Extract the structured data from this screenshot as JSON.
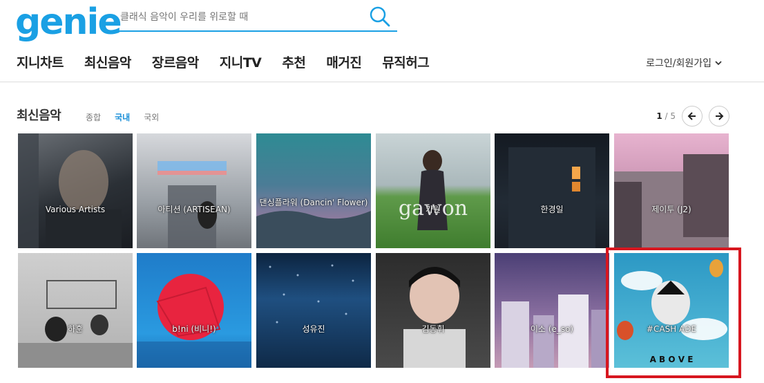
{
  "header": {
    "logo": "genie",
    "search_placeholder": "클래식 음악이 우리를 위로할 때"
  },
  "gnb": [
    "지니차트",
    "최신음악",
    "장르음악",
    "지니TV",
    "추천",
    "매거진",
    "뮤직허그"
  ],
  "login_label": "로그인/회원가입",
  "section": {
    "title": "최신음악",
    "tabs": [
      "종합",
      "국내",
      "국외"
    ],
    "active_tab": "국내",
    "page_current": "1",
    "page_sep": " / ",
    "page_total": "5"
  },
  "albums": [
    {
      "artist": "Various Artists",
      "bg": "#3a4048",
      "art_text": ""
    },
    {
      "artist": "아티션 (ARTISEAN)",
      "bg": "#b9bfc4",
      "art_text": ""
    },
    {
      "artist": "댄싱플라워 (Dancin' Flower)",
      "bg": "#2c6b78",
      "art_text": ""
    },
    {
      "artist": "가원",
      "bg": "#8aa5a8",
      "art_text": "gawon"
    },
    {
      "artist": "한경일",
      "bg": "#1e2530",
      "art_text": ""
    },
    {
      "artist": "제이투 (J2)",
      "bg": "#c9a2b6",
      "art_text": ""
    },
    {
      "artist": "하훈",
      "bg": "#b8b8b8",
      "art_text": ""
    },
    {
      "artist": "b!ni (비니!)",
      "bg": "#1f84d0",
      "art_text": ""
    },
    {
      "artist": "성유진",
      "bg": "#163a5e",
      "art_text": ""
    },
    {
      "artist": "김동휘",
      "bg": "#3b3b3b",
      "art_text": ""
    },
    {
      "artist": "이소 (e_so)",
      "bg": "#6a5a86",
      "art_text": ""
    },
    {
      "artist": "#CASH ADE",
      "bg": "#3aa3c4",
      "art_text": "A B O V E"
    }
  ]
}
